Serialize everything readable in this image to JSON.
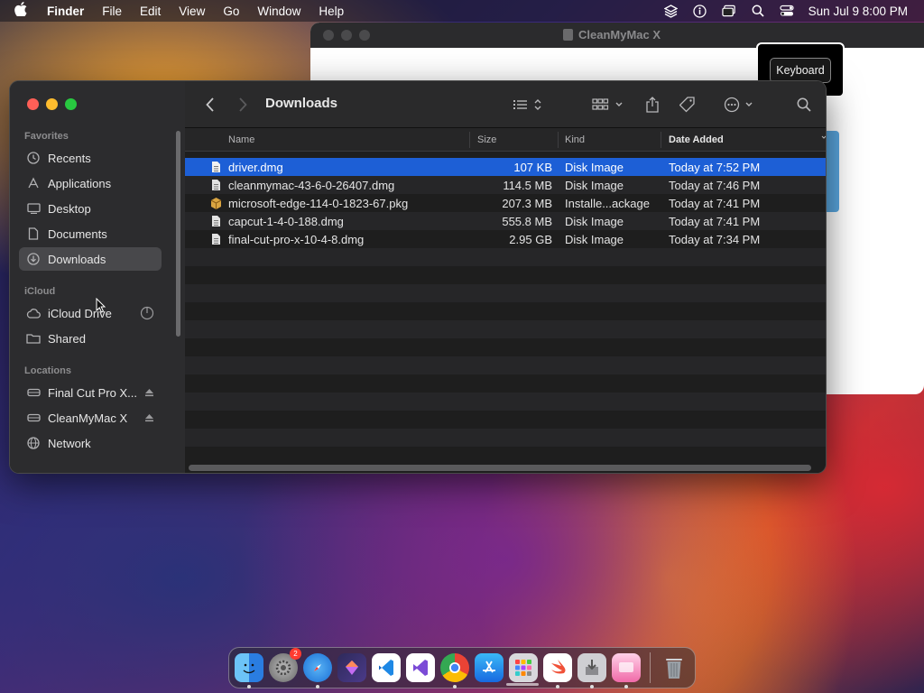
{
  "menubar": {
    "app_name": "Finder",
    "menus": [
      "File",
      "Edit",
      "View",
      "Go",
      "Window",
      "Help"
    ],
    "clock": "Sun Jul 9  8:00 PM"
  },
  "background_window": {
    "title": "CleanMyMac X"
  },
  "tooltip": {
    "label": "Keyboard"
  },
  "finder": {
    "title": "Downloads",
    "sidebar": {
      "sections": [
        {
          "title": "Favorites"
        },
        {
          "title": "iCloud"
        },
        {
          "title": "Locations"
        }
      ],
      "items": [
        {
          "label": "Recents",
          "icon": "clock-icon"
        },
        {
          "label": "Applications",
          "icon": "applications-icon"
        },
        {
          "label": "Desktop",
          "icon": "desktop-icon"
        },
        {
          "label": "Documents",
          "icon": "document-icon"
        },
        {
          "label": "Downloads",
          "icon": "download-icon",
          "active": true
        },
        {
          "label": "iCloud Drive",
          "icon": "cloud-icon"
        },
        {
          "label": "Shared",
          "icon": "shared-folder-icon"
        },
        {
          "label": "Final Cut Pro X...",
          "icon": "drive-icon"
        },
        {
          "label": "CleanMyMac X",
          "icon": "drive-icon"
        },
        {
          "label": "Network",
          "icon": "network-icon"
        }
      ]
    },
    "columns": {
      "name": "Name",
      "size": "Size",
      "kind": "Kind",
      "date": "Date Added"
    },
    "files": [
      {
        "name": "driver.dmg",
        "size": "107 KB",
        "kind": "Disk Image",
        "date": "Today at 7:52 PM",
        "selected": true
      },
      {
        "name": "cleanmymac-43-6-0-26407.dmg",
        "size": "114.5 MB",
        "kind": "Disk Image",
        "date": "Today at 7:46 PM"
      },
      {
        "name": "microsoft-edge-114-0-1823-67.pkg",
        "size": "207.3 MB",
        "kind": "Installe...ackage",
        "date": "Today at 7:41 PM"
      },
      {
        "name": "capcut-1-4-0-188.dmg",
        "size": "555.8 MB",
        "kind": "Disk Image",
        "date": "Today at 7:41 PM"
      },
      {
        "name": "final-cut-pro-x-10-4-8.dmg",
        "size": "2.95 GB",
        "kind": "Disk Image",
        "date": "Today at 7:34 PM"
      }
    ]
  },
  "dock": {
    "apps": [
      "finder-icon",
      "system-settings-icon",
      "safari-icon",
      "affinity-icon",
      "vscode-icon",
      "visual-studio-icon",
      "chrome-icon",
      "app-store-icon",
      "launchpad-icon",
      "swift-icon",
      "installer-icon",
      "cleanmymac-icon",
      "trash-icon"
    ],
    "settings_badge": "2"
  }
}
